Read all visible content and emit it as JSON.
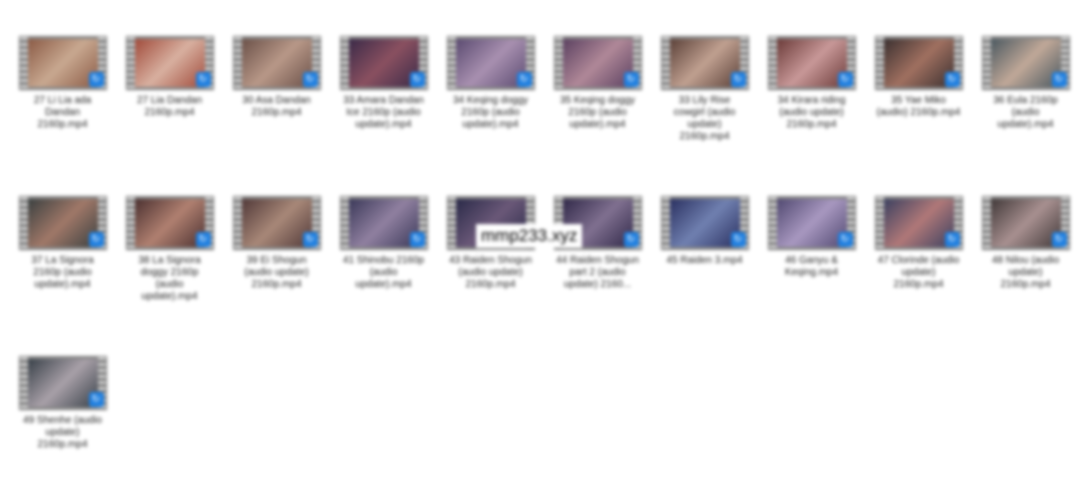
{
  "files": [
    {
      "label": "27 Li Lia ada Dandan 2160p.mp4",
      "colors": [
        "#8a5a45",
        "#c8a890"
      ]
    },
    {
      "label": "27 Lia Dandan 2160p.mp4",
      "colors": [
        "#a04a3a",
        "#d8b0a0"
      ]
    },
    {
      "label": "30 Asa Dandan 2160p.mp4",
      "colors": [
        "#6a5048",
        "#b89888"
      ]
    },
    {
      "label": "33 Amara Dandan Ice 2160p (audio update).mp4",
      "colors": [
        "#3a2a48",
        "#8a5060"
      ]
    },
    {
      "label": "34 Keqing doggy 2160p (audio update).mp4",
      "colors": [
        "#5a4a70",
        "#a890b0"
      ]
    },
    {
      "label": "35 Keqing doggy 2160p (audio update).mp4",
      "colors": [
        "#5a4060",
        "#b08898"
      ]
    },
    {
      "label": "33 Lily Rise cowgirl (audio update) 2160p.mp4",
      "colors": [
        "#5a4038",
        "#c0a090"
      ]
    },
    {
      "label": "34 Kirara riding (audio update) 2160p.mp4",
      "colors": [
        "#6a3a38",
        "#c89898"
      ]
    },
    {
      "label": "35 Yae Miko (audio) 2160p.mp4",
      "colors": [
        "#3a3030",
        "#a07060"
      ]
    },
    {
      "label": "36 Eula 2160p (audio update).mp4",
      "colors": [
        "#4a5860",
        "#c0a898"
      ]
    },
    {
      "label": "37 La Signora 2160p (audio update).mp4",
      "colors": [
        "#3a4040",
        "#a07868"
      ]
    },
    {
      "label": "38 La Signora doggy 2160p (audio update).mp4",
      "colors": [
        "#4a3030",
        "#b08070"
      ]
    },
    {
      "label": "39 Ei Shogun (audio update) 2160p.mp4",
      "colors": [
        "#503838",
        "#a88878"
      ]
    },
    {
      "label": "41 Shinobu 2160p (audio update).mp4",
      "colors": [
        "#3a3858",
        "#9080a0"
      ]
    },
    {
      "label": "43 Raiden Shogun (audio update) 2160p.mp4",
      "colors": [
        "#2a2a48",
        "#6a5878"
      ]
    },
    {
      "label": "44 Raiden Shogun part 2 (audio update) 2160...",
      "colors": [
        "#302848",
        "#807090"
      ]
    },
    {
      "label": "45 Raiden 3.mp4",
      "colors": [
        "#2a3060",
        "#7080b0"
      ]
    },
    {
      "label": "46 Ganyu & Keqing.mp4",
      "colors": [
        "#504870",
        "#a898c0"
      ]
    },
    {
      "label": "47 Clorinde (audio update) 2160p.mp4",
      "colors": [
        "#3a4060",
        "#b07878"
      ]
    },
    {
      "label": "48 Nilou (audio update) 2160p.mp4",
      "colors": [
        "#403838",
        "#a89090"
      ]
    },
    {
      "label": "49 Shenhe (audio update) 2160p.mp4",
      "colors": [
        "#384048",
        "#a8a0a8"
      ]
    }
  ],
  "watermark": "mmp233.xyz"
}
